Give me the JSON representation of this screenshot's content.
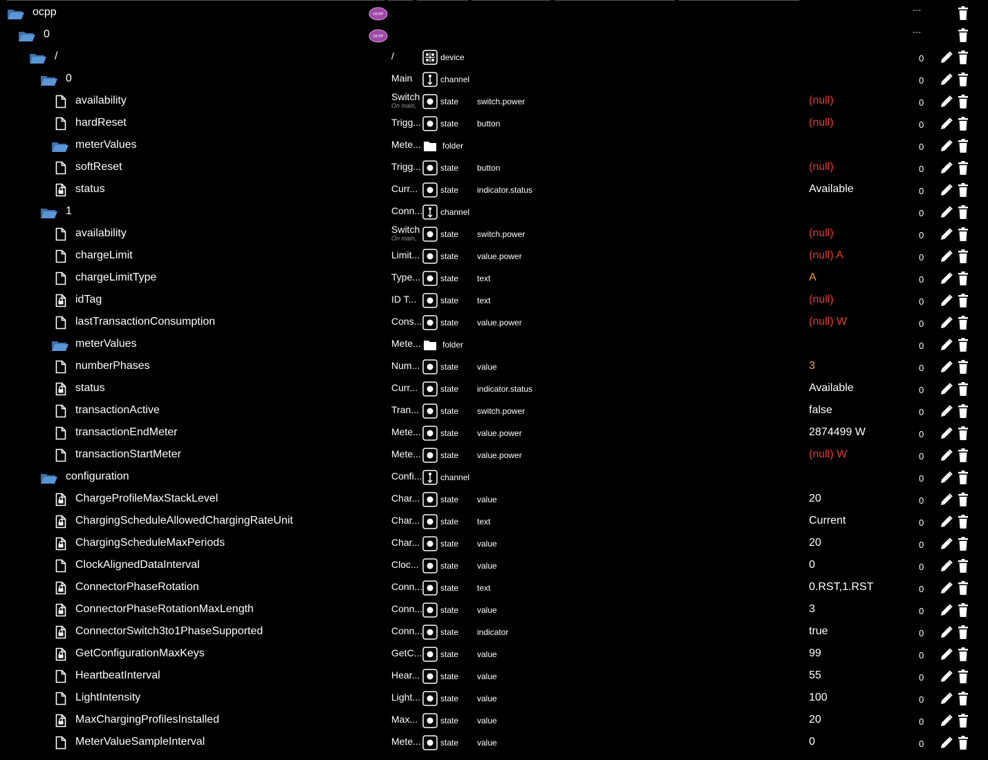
{
  "colors": {
    "background": "#000000",
    "text": "#ffffff",
    "null_red": "#e53935",
    "orange": "#f5a623",
    "folder_blue": "#4a83c4",
    "logo_purple": "#a048a8"
  },
  "icons": {
    "folder": "folder-open-icon",
    "file": "file-icon",
    "locked_file": "file-lock-icon",
    "adapter_logo": "ocpp-logo-icon",
    "device": "device-icon",
    "channel": "channel-icon",
    "state": "state-icon",
    "folder_type": "folder-type-icon",
    "edit": "pencil-icon",
    "delete": "trash-icon"
  },
  "rows": [
    {
      "level": 0,
      "icon": "folder",
      "name": "ocpp",
      "logo": true,
      "dash": "---"
    },
    {
      "level": 1,
      "icon": "folder",
      "name": "0",
      "logo": true,
      "dash": "---"
    },
    {
      "level": 2,
      "icon": "folder",
      "name": "/",
      "nm": "/",
      "type": "device",
      "ack": "0"
    },
    {
      "level": 3,
      "icon": "folder",
      "name": "0",
      "nm": "Main",
      "type": "channel",
      "ack": "0"
    },
    {
      "level": 4,
      "icon": "file",
      "name": "availability",
      "nm": "Switch",
      "nmsub": "On main,",
      "type": "state",
      "role": "switch.power",
      "val": "(null)",
      "vcolor": "null_red",
      "ack": "0"
    },
    {
      "level": 4,
      "icon": "file",
      "name": "hardReset",
      "nm": "Trigg...",
      "type": "state",
      "role": "button",
      "val": "(null)",
      "vcolor": "null_red",
      "ack": "0"
    },
    {
      "level": 4,
      "icon": "folder",
      "name": "meterValues",
      "nm": "Mete...",
      "type": "folder",
      "ack": "0"
    },
    {
      "level": 4,
      "icon": "file",
      "name": "softReset",
      "nm": "Trigg...",
      "type": "state",
      "role": "button",
      "val": "(null)",
      "vcolor": "null_red",
      "ack": "0"
    },
    {
      "level": 4,
      "icon": "locked_file",
      "name": "status",
      "nm": "Curr...",
      "type": "state",
      "role": "indicator.status",
      "val": "Available",
      "ack": "0"
    },
    {
      "level": 3,
      "icon": "folder",
      "name": "1",
      "nm": "Conn...",
      "type": "channel",
      "ack": "0"
    },
    {
      "level": 4,
      "icon": "file",
      "name": "availability",
      "nm": "Switch",
      "nmsub": "On main,",
      "type": "state",
      "role": "switch.power",
      "val": "(null)",
      "vcolor": "null_red",
      "ack": "0"
    },
    {
      "level": 4,
      "icon": "file",
      "name": "chargeLimit",
      "nm": "Limit...",
      "type": "state",
      "role": "value.power",
      "val": "(null) A",
      "vcolor": "null_red",
      "ack": "0"
    },
    {
      "level": 4,
      "icon": "file",
      "name": "chargeLimitType",
      "nm": "Type...",
      "type": "state",
      "role": "text",
      "val": "A",
      "vcolor": "orange",
      "ack": "0"
    },
    {
      "level": 4,
      "icon": "locked_file",
      "name": "idTag",
      "nm": "ID T...",
      "type": "state",
      "role": "text",
      "val": "(null)",
      "vcolor": "null_red",
      "ack": "0"
    },
    {
      "level": 4,
      "icon": "file",
      "name": "lastTransactionConsumption",
      "nm": "Cons...",
      "type": "state",
      "role": "value.power",
      "val": "(null) W",
      "vcolor": "null_red",
      "ack": "0"
    },
    {
      "level": 4,
      "icon": "folder",
      "name": "meterValues",
      "nm": "Mete...",
      "type": "folder",
      "ack": "0"
    },
    {
      "level": 4,
      "icon": "file",
      "name": "numberPhases",
      "nm": "Num...",
      "type": "state",
      "role": "value",
      "val": "3",
      "vcolor": "orange",
      "ack": "0"
    },
    {
      "level": 4,
      "icon": "locked_file",
      "name": "status",
      "nm": "Curr...",
      "type": "state",
      "role": "indicator.status",
      "val": "Available",
      "ack": "0"
    },
    {
      "level": 4,
      "icon": "file",
      "name": "transactionActive",
      "nm": "Tran...",
      "type": "state",
      "role": "switch.power",
      "val": "false",
      "ack": "0"
    },
    {
      "level": 4,
      "icon": "file",
      "name": "transactionEndMeter",
      "nm": "Mete...",
      "type": "state",
      "role": "value.power",
      "val": "2874499 W",
      "ack": "0"
    },
    {
      "level": 4,
      "icon": "file",
      "name": "transactionStartMeter",
      "nm": "Mete...",
      "type": "state",
      "role": "value.power",
      "val": "(null) W",
      "vcolor": "null_red",
      "ack": "0"
    },
    {
      "level": 3,
      "icon": "folder",
      "name": "configuration",
      "nm": "Confi...",
      "type": "channel",
      "ack": "0"
    },
    {
      "level": 4,
      "icon": "locked_file",
      "name": "ChargeProfileMaxStackLevel",
      "nm": "Char...",
      "type": "state",
      "role": "value",
      "val": "20",
      "ack": "0"
    },
    {
      "level": 4,
      "icon": "locked_file",
      "name": "ChargingScheduleAllowedChargingRateUnit",
      "nm": "Char...",
      "type": "state",
      "role": "text",
      "val": "Current",
      "ack": "0"
    },
    {
      "level": 4,
      "icon": "locked_file",
      "name": "ChargingScheduleMaxPeriods",
      "nm": "Char...",
      "type": "state",
      "role": "value",
      "val": "20",
      "ack": "0"
    },
    {
      "level": 4,
      "icon": "file",
      "name": "ClockAlignedDataInterval",
      "nm": "Cloc...",
      "type": "state",
      "role": "value",
      "val": "0",
      "ack": "0"
    },
    {
      "level": 4,
      "icon": "locked_file",
      "name": "ConnectorPhaseRotation",
      "nm": "Conn...",
      "type": "state",
      "role": "text",
      "val": "0.RST,1.RST",
      "ack": "0"
    },
    {
      "level": 4,
      "icon": "locked_file",
      "name": "ConnectorPhaseRotationMaxLength",
      "nm": "Conn...",
      "type": "state",
      "role": "value",
      "val": "3",
      "ack": "0"
    },
    {
      "level": 4,
      "icon": "locked_file",
      "name": "ConnectorSwitch3to1PhaseSupported",
      "nm": "Conn...",
      "type": "state",
      "role": "indicator",
      "val": "true",
      "ack": "0"
    },
    {
      "level": 4,
      "icon": "locked_file",
      "name": "GetConfigurationMaxKeys",
      "nm": "GetC...",
      "type": "state",
      "role": "value",
      "val": "99",
      "ack": "0"
    },
    {
      "level": 4,
      "icon": "file",
      "name": "HeartbeatInterval",
      "nm": "Hear...",
      "type": "state",
      "role": "value",
      "val": "55",
      "ack": "0"
    },
    {
      "level": 4,
      "icon": "file",
      "name": "LightIntensity",
      "nm": "Light...",
      "type": "state",
      "role": "value",
      "val": "100",
      "ack": "0"
    },
    {
      "level": 4,
      "icon": "locked_file",
      "name": "MaxChargingProfilesInstalled",
      "nm": "Max...",
      "type": "state",
      "role": "value",
      "val": "20",
      "ack": "0"
    },
    {
      "level": 4,
      "icon": "file",
      "name": "MeterValueSampleInterval",
      "nm": "Mete...",
      "type": "state",
      "role": "value",
      "val": "0",
      "ack": "0"
    }
  ]
}
